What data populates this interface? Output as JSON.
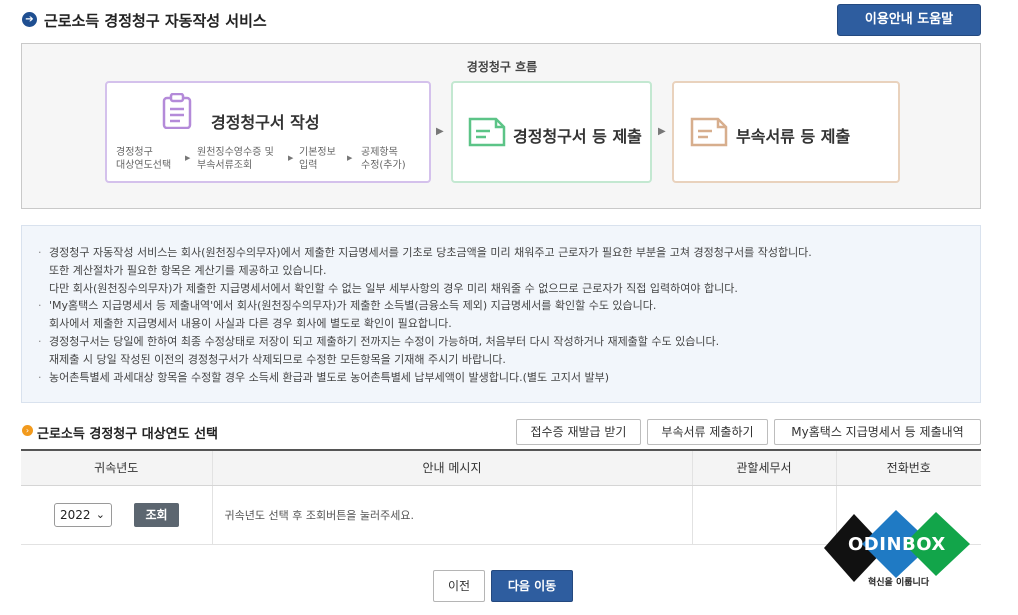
{
  "header": {
    "title": "근로소득 경정청구 자동작성 서비스",
    "help_button": "이용안내 도움말"
  },
  "flow": {
    "title": "경정청구 흐름",
    "step1": {
      "title": "경정청구서 작성",
      "substeps": [
        {
          "line1": "경정청구",
          "line2": "대상연도선택"
        },
        {
          "line1": "원천징수영수증 및",
          "line2": "부속서류조회"
        },
        {
          "line1": "기본정보",
          "line2": "입력"
        },
        {
          "line1": "공제항목",
          "line2": "수정(추가)"
        }
      ]
    },
    "step2": {
      "title": "경정청구서 등 제출"
    },
    "step3": {
      "title": "부속서류 등 제출"
    }
  },
  "info": {
    "lines": [
      "경정청구 자동작성 서비스는 회사(원천징수의무자)에서 제출한 지급명세서를 기초로 당초금액을 미리 채워주고 근로자가 필요한 부분을 고쳐 경정청구서를 작성합니다.",
      "또한 계산절차가 필요한 항목은 계산기를 제공하고 있습니다.",
      "다만 회사(원천징수의무자)가 제출한 지급명세서에서 확인할 수 없는 일부 세부사항의 경우 미리 채워줄 수 없으므로 근로자가 직접 입력하여야 합니다.",
      "'My홈택스 지급명세서 등 제출내역'에서 회사(원천징수의무자)가 제출한 소득별(금융소득 제외) 지급명세서를 확인할 수도 있습니다.",
      "회사에서 제출한 지급명세서 내용이 사실과 다른 경우 회사에 별도로 확인이 필요합니다.",
      "경정청구서는 당일에 한하여 최종 수정상태로 저장이 되고 제출하기 전까지는 수정이 가능하며, 처음부터 다시 작성하거나 재제출할 수도 있습니다.",
      "재제출 시 당일 작성된 이전의 경정청구서가 삭제되므로 수정한 모든항목을 기재해 주시기 바랍니다.",
      "농어촌특별세 과세대상 항목을 수정할 경우 소득세 환급과 별도로 농어촌특별세 납부세액이 발생합니다.(별도 고지서 발부)"
    ],
    "bullets": [
      true,
      false,
      false,
      true,
      false,
      true,
      false,
      true
    ]
  },
  "section": {
    "title": "근로소득 경정청구 대상연도 선택",
    "buttons": [
      "접수증 재발급 받기",
      "부속서류 제출하기",
      "My홈택스 지급명세서 등 제출내역"
    ]
  },
  "table": {
    "headers": [
      "귀속년도",
      "안내 메시지",
      "관할세무서",
      "전화번호"
    ],
    "row": {
      "year_value": "2022",
      "inquiry_button": "조회",
      "message": "귀속년도 선택 후 조회버튼을 눌러주세요.",
      "tax_office": "",
      "phone": ""
    }
  },
  "watermark": {
    "text": "ODINBOX",
    "subtext": "혁신을 이룹니다",
    "colors": [
      "#1f7ac4",
      "#12a54a",
      "#111111"
    ]
  },
  "nav": {
    "prev": "이전",
    "next": "다음 이동"
  },
  "colors": {
    "primary": "#2e5d9f",
    "accent_orange": "#f29a1d",
    "step1_border": "#d4c1ec",
    "step2_border": "#c3e8d1",
    "step3_border": "#e9d2bd"
  }
}
